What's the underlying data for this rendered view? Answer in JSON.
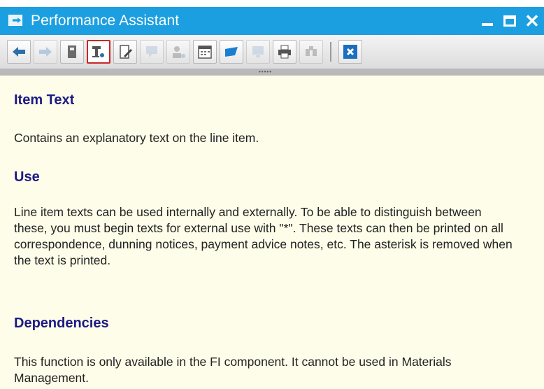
{
  "window": {
    "title": "Performance Assistant",
    "close_glyph": "✕"
  },
  "toolbar": {
    "buttons": [
      {
        "icon": "back-arrow-icon",
        "state": "enabled"
      },
      {
        "icon": "forward-arrow-icon",
        "state": "disabled"
      },
      {
        "icon": "book-icon",
        "state": "enabled"
      },
      {
        "icon": "technical-info-icon",
        "state": "selected"
      },
      {
        "icon": "edit-document-icon",
        "state": "enabled"
      },
      {
        "icon": "comment-icon",
        "state": "disabled"
      },
      {
        "icon": "user-settings-icon",
        "state": "disabled"
      },
      {
        "icon": "calendar-icon",
        "state": "enabled"
      },
      {
        "icon": "flag-icon",
        "state": "enabled"
      },
      {
        "icon": "display-icon",
        "state": "disabled"
      },
      {
        "icon": "print-icon",
        "state": "enabled"
      },
      {
        "icon": "find-icon",
        "state": "disabled"
      },
      {
        "icon": "close-window-icon",
        "state": "enabled"
      }
    ]
  },
  "content": {
    "sections": [
      {
        "heading": "Item Text",
        "body": "Contains an explanatory text on the line item."
      },
      {
        "heading": "Use",
        "body": "Line item texts can be used internally and externally. To be able to distinguish between these, you must begin texts for external use with \"*\". These texts can then be printed on all correspondence, dunning notices, payment advice notes, etc. The asterisk is removed when the text is printed."
      },
      {
        "heading": "Dependencies",
        "body": "This function is only available in the FI component. It cannot be used in Materials Management."
      }
    ]
  },
  "colors": {
    "title_bar": "#1c9fe0",
    "content_bg": "#fdfde9",
    "heading": "#1c1a85",
    "selected_border": "#c8282a"
  }
}
